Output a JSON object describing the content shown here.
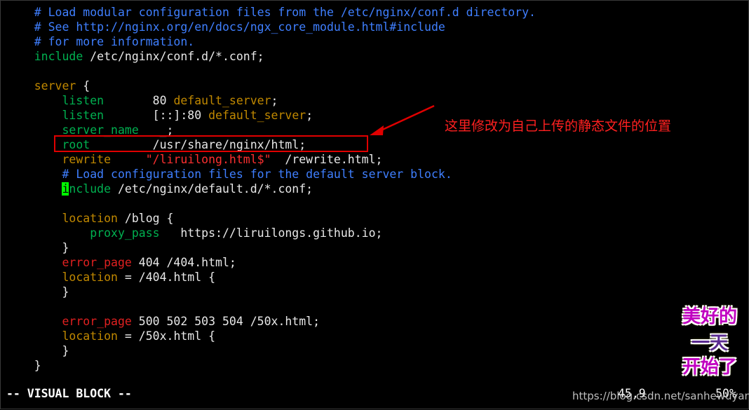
{
  "editor": {
    "lines": [
      {
        "segments": [
          {
            "t": "    ",
            "c": ""
          },
          {
            "t": "# Load modular configuration files from the /etc/nginx/conf.d directory.",
            "c": "cmt"
          }
        ]
      },
      {
        "segments": [
          {
            "t": "    ",
            "c": ""
          },
          {
            "t": "# See http://nginx.org/en/docs/ngx_core_module.html#include",
            "c": "cmt"
          }
        ]
      },
      {
        "segments": [
          {
            "t": "    ",
            "c": ""
          },
          {
            "t": "# for more information.",
            "c": "cmt"
          }
        ]
      },
      {
        "segments": [
          {
            "t": "    ",
            "c": ""
          },
          {
            "t": "include",
            "c": "kw"
          },
          {
            "t": " /etc/nginx/conf.d/*.conf;",
            "c": ""
          }
        ]
      },
      {
        "segments": [
          {
            "t": "",
            "c": ""
          }
        ]
      },
      {
        "segments": [
          {
            "t": "    ",
            "c": ""
          },
          {
            "t": "server",
            "c": "kw2"
          },
          {
            "t": " {",
            "c": ""
          }
        ]
      },
      {
        "segments": [
          {
            "t": "        ",
            "c": ""
          },
          {
            "t": "listen",
            "c": "kw"
          },
          {
            "t": "       80 ",
            "c": ""
          },
          {
            "t": "default_server",
            "c": "kw2"
          },
          {
            "t": ";",
            "c": ""
          }
        ]
      },
      {
        "segments": [
          {
            "t": "        ",
            "c": ""
          },
          {
            "t": "listen",
            "c": "kw"
          },
          {
            "t": "       [::]:80 ",
            "c": ""
          },
          {
            "t": "default_server",
            "c": "kw2"
          },
          {
            "t": ";",
            "c": ""
          }
        ]
      },
      {
        "segments": [
          {
            "t": "        ",
            "c": ""
          },
          {
            "t": "server_name",
            "c": "kw"
          },
          {
            "t": "   _;",
            "c": ""
          }
        ]
      },
      {
        "segments": [
          {
            "t": "        ",
            "c": ""
          },
          {
            "t": "root",
            "c": "kw"
          },
          {
            "t": "         /usr/share/nginx/html;",
            "c": ""
          }
        ]
      },
      {
        "segments": [
          {
            "t": "        ",
            "c": ""
          },
          {
            "t": "rewrite",
            "c": "kw2"
          },
          {
            "t": "     ",
            "c": ""
          },
          {
            "t": "\"/liruilong.html$\"",
            "c": "str"
          },
          {
            "t": "  /rewrite.html;",
            "c": ""
          }
        ]
      },
      {
        "segments": [
          {
            "t": "        ",
            "c": ""
          },
          {
            "t": "# Load configuration files for the default server block.",
            "c": "cmt"
          }
        ]
      },
      {
        "segments": [
          {
            "t": "        ",
            "c": ""
          },
          {
            "t": "i",
            "c": "cursor"
          },
          {
            "t": "nclude",
            "c": "kw"
          },
          {
            "t": " /etc/nginx/default.d/*.conf;",
            "c": ""
          }
        ]
      },
      {
        "segments": [
          {
            "t": "",
            "c": ""
          }
        ]
      },
      {
        "segments": [
          {
            "t": "        ",
            "c": ""
          },
          {
            "t": "location",
            "c": "kw2"
          },
          {
            "t": " /blog {",
            "c": ""
          }
        ]
      },
      {
        "segments": [
          {
            "t": "            ",
            "c": ""
          },
          {
            "t": "proxy_pass",
            "c": "kw"
          },
          {
            "t": "   https://liruilongs.github.io;",
            "c": ""
          }
        ]
      },
      {
        "segments": [
          {
            "t": "        }",
            "c": ""
          }
        ]
      },
      {
        "segments": [
          {
            "t": "        ",
            "c": ""
          },
          {
            "t": "error_page",
            "c": "red"
          },
          {
            "t": " 404 /404.html;",
            "c": ""
          }
        ]
      },
      {
        "segments": [
          {
            "t": "        ",
            "c": ""
          },
          {
            "t": "location",
            "c": "kw2"
          },
          {
            "t": " = /404.html {",
            "c": ""
          }
        ]
      },
      {
        "segments": [
          {
            "t": "        }",
            "c": ""
          }
        ]
      },
      {
        "segments": [
          {
            "t": "",
            "c": ""
          }
        ]
      },
      {
        "segments": [
          {
            "t": "        ",
            "c": ""
          },
          {
            "t": "error_page",
            "c": "red"
          },
          {
            "t": " 500 502 503 504 /50x.html;",
            "c": ""
          }
        ]
      },
      {
        "segments": [
          {
            "t": "        ",
            "c": ""
          },
          {
            "t": "location",
            "c": "kw2"
          },
          {
            "t": " = /50x.html {",
            "c": ""
          }
        ]
      },
      {
        "segments": [
          {
            "t": "        }",
            "c": ""
          }
        ]
      },
      {
        "segments": [
          {
            "t": "    }",
            "c": ""
          }
        ]
      }
    ]
  },
  "annotation": {
    "text": "这里修改为自己上传的静态文件的位置"
  },
  "status": {
    "mode": "-- VISUAL BLOCK --",
    "position": "45,9",
    "percent": "50%"
  },
  "watermark": {
    "text": "https://blog.csdn.net/sanhewuyang"
  },
  "sticker": {
    "line1": "美好的",
    "line2": "一天",
    "line3": "开始了"
  },
  "colors": {
    "background": "#000000",
    "comment": "#3f7fff",
    "keyword": "#00b050",
    "directive": "#c08800",
    "string": "#ff3030",
    "annotation": "#ff2020",
    "cursor": "#00ff00"
  }
}
